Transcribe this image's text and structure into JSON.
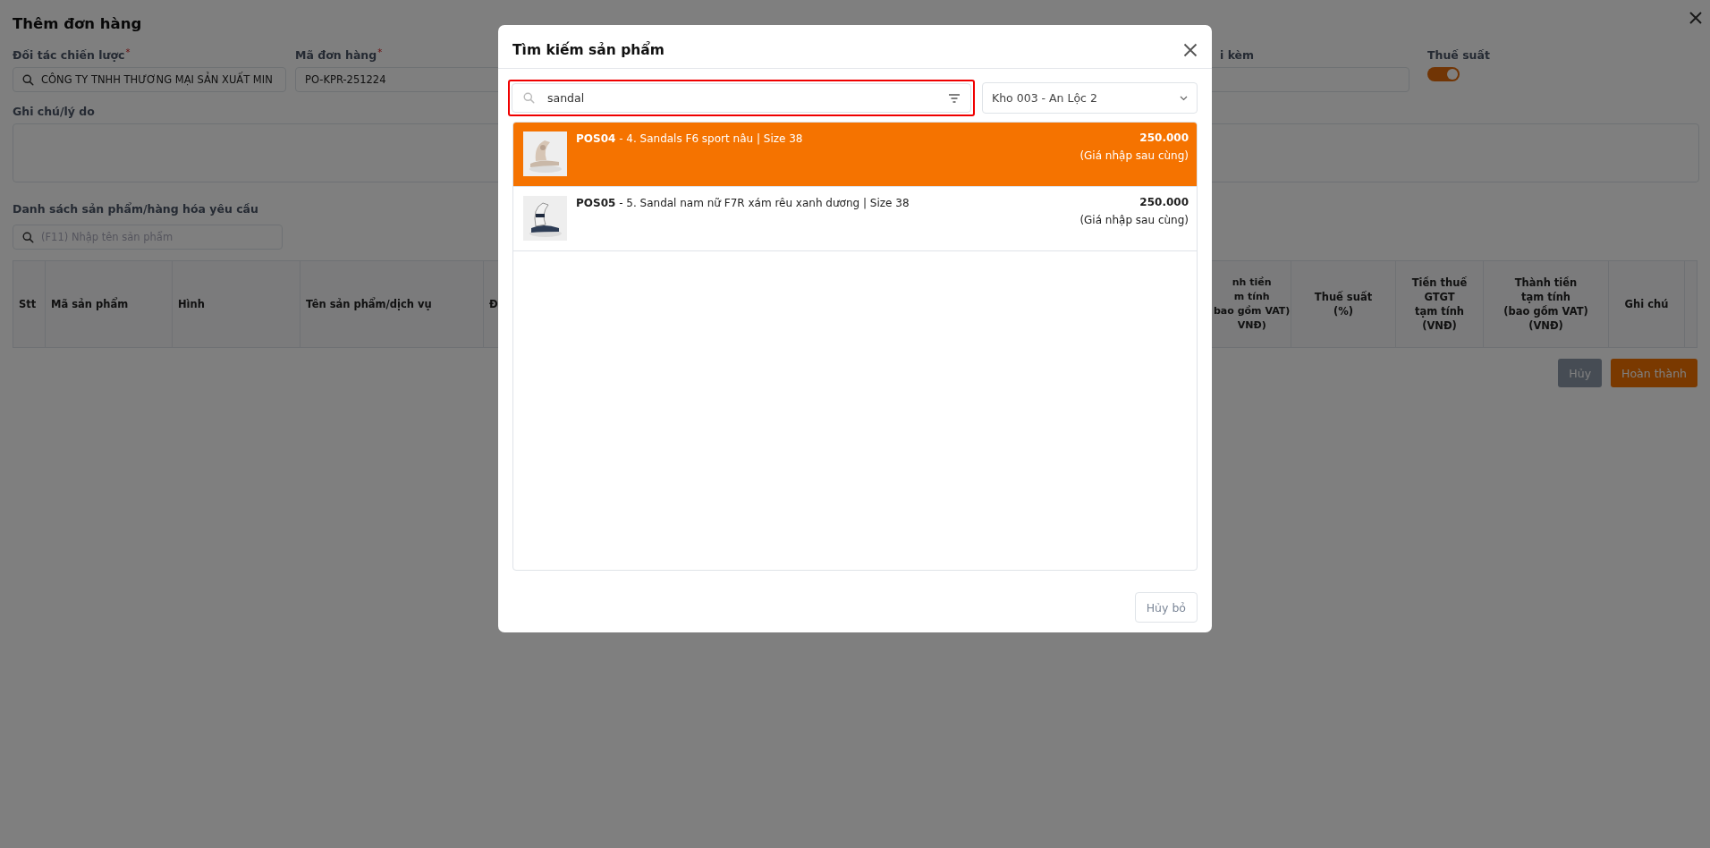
{
  "page": {
    "title": "Thêm đơn hàng",
    "fields": [
      {
        "label": "Đối tác chiến lược",
        "required_mark": "*",
        "value": "CÔNG TY TNHH THƯƠNG MẠI SẢN XUẤT MIN",
        "search": true
      },
      {
        "label": "Mã đơn hàng",
        "required_mark": "*",
        "value": "PO-KPR-251224",
        "search": false
      }
    ],
    "attach_label": "i kèm",
    "tax": {
      "label": "Thuế suất",
      "on": true
    },
    "note_label": "Ghi chú/lý do",
    "products_label": "Danh sách sản phẩm/hàng hóa yêu cầu",
    "product_search": {
      "placeholder": "(F11) Nhập tên sản phẩm"
    },
    "table": {
      "columns": [
        "Stt",
        "Mã sản phẩm",
        "Hình",
        "Tên sản phẩm/dịch vụ",
        "Đ",
        "nh tiền\nm tính\nbao gồm VAT)\nVNĐ)",
        "Thuế suất\n(%)",
        "Tiền thuế\nGTGT\ntạm tính\n(VNĐ)",
        "Thành tiền\ntạm tính\n(bao gồm VAT)\n(VNĐ)",
        "Ghi chú"
      ]
    },
    "buttons": [
      {
        "kind": "secondary",
        "label": "Hủy"
      },
      {
        "kind": "primary",
        "label": "Hoàn thành"
      }
    ]
  },
  "modal": {
    "title": "Tìm kiếm sản phẩm",
    "search": {
      "value": "sandal",
      "highlighted": true
    },
    "warehouse": "Kho 003 - An Lộc 2",
    "results": [
      {
        "code": "POS04",
        "name": " - 4. Sandals F6 sport nâu | Size 38",
        "price": "250.000",
        "note": "(Giá nhập sau cùng)",
        "selected": true
      },
      {
        "code": "POS05",
        "name": " - 5. Sandal nam nữ F7R xám rêu xanh dương | Size 38",
        "price": "250.000",
        "note": "(Giá nhập sau cùng)",
        "selected": false
      }
    ],
    "cancel": "Hủy bỏ"
  }
}
